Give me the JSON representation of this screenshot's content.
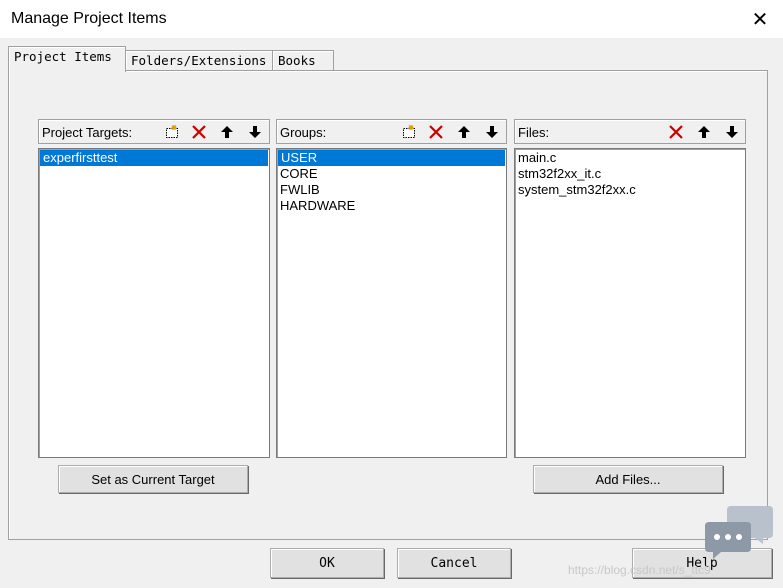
{
  "window": {
    "title": "Manage Project Items",
    "close_glyph": "✕"
  },
  "tabs": [
    {
      "label": "Project Items",
      "active": true
    },
    {
      "label": "Folders/Extensions",
      "active": false
    },
    {
      "label": "Books",
      "active": false
    }
  ],
  "targets": {
    "label": "Project Targets:",
    "items": [
      "experfirsttest"
    ],
    "selected_index": 0
  },
  "groups": {
    "label": "Groups:",
    "items": [
      "USER",
      "CORE",
      "FWLIB",
      "HARDWARE"
    ],
    "selected_index": 0
  },
  "files": {
    "label": "Files:",
    "items": [
      "main.c",
      "stm32f2xx_it.c",
      "system_stm32f2xx.c"
    ]
  },
  "buttons": {
    "set_current_target": "Set as Current Target",
    "add_files": "Add Files...",
    "ok": "OK",
    "cancel": "Cancel",
    "help": "Help"
  },
  "toolbar_icons": [
    "new-icon",
    "delete-icon",
    "move-up-icon",
    "move-down-icon"
  ],
  "colors": {
    "selection": "#0078d7",
    "delete_red": "#cc0000"
  },
  "watermark": "https://blog.csdn.net/s_ttc9"
}
